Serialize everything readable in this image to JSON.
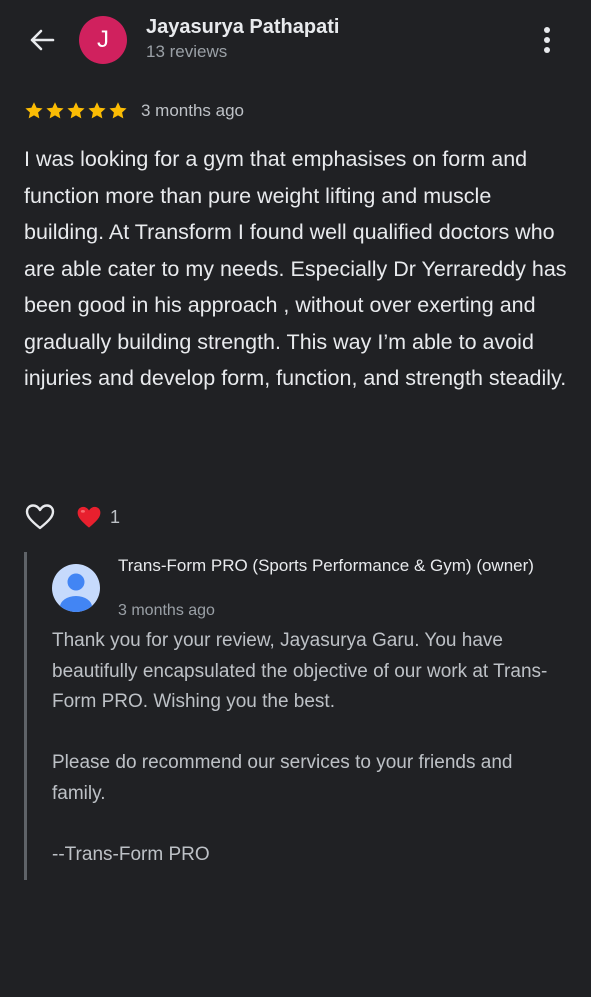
{
  "header": {
    "reviewer_name": "Jayasurya Pathapati",
    "reviewer_initial": "J",
    "review_count": "13 reviews",
    "avatar_color": "#d0215e",
    "back_icon": "arrow-left-icon",
    "menu_icon": "more-vertical-icon"
  },
  "review": {
    "rating": 5,
    "max_rating": 5,
    "star_color": "#fbbc04",
    "date": "3 months ago",
    "text": "I was looking for a gym that emphasises on form and function more than pure weight lifting and muscle building. At Transform I found well qualified doctors who are able cater to my needs. Especially Dr Yerrareddy has been good in his approach , without over exerting and gradually building strength. This way I’m able to avoid injuries and develop form, function, and strength steadily."
  },
  "actions": {
    "like_icon": "heart-outline-icon",
    "reaction_icon": "red-heart-icon",
    "reaction_count": "1"
  },
  "owner_reply": {
    "name": "Trans-Form PRO (Sports Performance & Gym) (owner)",
    "avatar_icon": "person-icon",
    "date": "3 months ago",
    "paragraphs": [
      "Thank you for your review, Jayasurya Garu. You have beautifully encapsulated the objective of our work at Trans-Form PRO. Wishing you the best.",
      "Please do recommend our services to your friends and family.",
      "--Trans-Form PRO"
    ]
  }
}
